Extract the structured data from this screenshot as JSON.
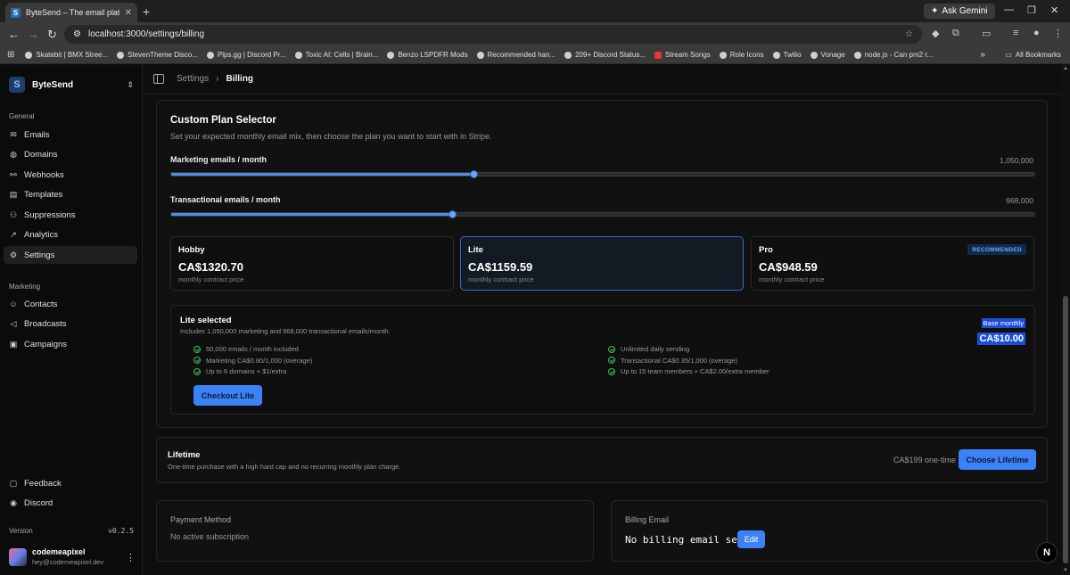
{
  "browser": {
    "tab_title": "ByteSend – The email platform",
    "url": "localhost:3000/settings/billing",
    "ask_gemini": "Ask Gemini",
    "bookmarks": [
      "Skatebit | BMX Stree...",
      "StevenTheme Disco...",
      "Plps.gg | Discord Pr...",
      "Toxic AI: Cells | Brain...",
      "Benzo LSPDFR Mods",
      "Recommended han...",
      "209+ Discord Status...",
      "Stream Songs",
      "Role Icons",
      "Twilio",
      "Vonage",
      "node.js - Can pm2 r..."
    ],
    "all_bookmarks": "All Bookmarks"
  },
  "sidebar": {
    "brand": "ByteSend",
    "general_label": "General",
    "general_items": [
      {
        "label": "Emails",
        "icon": "mail-icon"
      },
      {
        "label": "Domains",
        "icon": "globe-icon"
      },
      {
        "label": "Webhooks",
        "icon": "webhook-icon"
      },
      {
        "label": "Templates",
        "icon": "file-icon"
      },
      {
        "label": "Suppressions",
        "icon": "user-x-icon"
      },
      {
        "label": "Analytics",
        "icon": "chart-icon"
      },
      {
        "label": "Settings",
        "icon": "gear-icon"
      }
    ],
    "marketing_label": "Marketing",
    "marketing_items": [
      {
        "label": "Contacts",
        "icon": "contacts-icon"
      },
      {
        "label": "Broadcasts",
        "icon": "megaphone-icon"
      },
      {
        "label": "Campaigns",
        "icon": "campaign-icon"
      }
    ],
    "footer_items": [
      {
        "label": "Feedback",
        "icon": "message-icon"
      },
      {
        "label": "Discord",
        "icon": "discord-icon"
      }
    ],
    "version_label": "Version",
    "version": "v0.2.5",
    "user_name": "codemeapixel",
    "user_email": "hey@codemeapixel.dev"
  },
  "breadcrumb": {
    "parent": "Settings",
    "current": "Billing"
  },
  "plan_selector": {
    "title": "Custom Plan Selector",
    "subtitle": "Set your expected monthly email mix, then choose the plan you want to start with in Stripe.",
    "marketing_label": "Marketing emails / month",
    "marketing_value": "1,050,000",
    "marketing_fraction": 0.35,
    "transactional_label": "Transactional emails / month",
    "transactional_value": "968,000",
    "transactional_fraction": 0.325,
    "tiers": [
      {
        "name": "Hobby",
        "price": "CA$1320.70",
        "note": "monthly contract price"
      },
      {
        "name": "Lite",
        "price": "CA$1159.59",
        "note": "monthly contract price"
      },
      {
        "name": "Pro",
        "price": "CA$948.59",
        "note": "monthly contract price",
        "badge": "RECOMMENDED"
      }
    ],
    "selected_title": "Lite selected",
    "selected_sub": "Includes 1,050,000 marketing and 968,000 transactional emails/month.",
    "base_label": "Base monthly",
    "base_price": "CA$10.00",
    "features_left": [
      "50,000 emails / month included",
      "Marketing CA$0.80/1,000 (overage)",
      "Up to 6 domains + $1/extra"
    ],
    "features_right": [
      "Unlimited daily sending",
      "Transactional CA$0.35/1,000 (overage)",
      "Up to 15 team members + CA$2.00/extra member"
    ],
    "checkout_label": "Checkout Lite"
  },
  "lifetime": {
    "title": "Lifetime",
    "subtitle": "One-time purchase with a high hard cap and no recurring monthly plan charge.",
    "price": "CA$199 one-time",
    "button": "Choose Lifetime"
  },
  "payment": {
    "title": "Payment Method",
    "value": "No active subscription"
  },
  "billing_email": {
    "title": "Billing Email",
    "value": "No billing email set",
    "edit": "Edit"
  },
  "colors": {
    "accent": "#3b82f6",
    "selected_border": "#3b6bc0",
    "check": "#3fbf5f"
  }
}
